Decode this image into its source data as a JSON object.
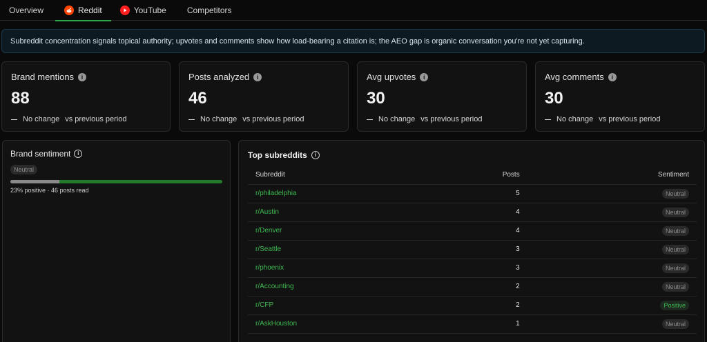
{
  "tabs": [
    {
      "label": "Overview",
      "icon": "",
      "active": false
    },
    {
      "label": "Reddit",
      "icon": "reddit-icon",
      "active": true
    },
    {
      "label": "YouTube",
      "icon": "youtube-icon",
      "active": false
    },
    {
      "label": "Competitors",
      "icon": "",
      "active": false
    }
  ],
  "banner": {
    "text": "Subreddit concentration signals topical authority; upvotes and comments show how load-bearing a citation is; the AEO gap is organic conversation you're not yet capturing."
  },
  "cards": [
    {
      "title": "Brand mentions",
      "value": "88",
      "change": "No change",
      "period": "vs previous period"
    },
    {
      "title": "Posts analyzed",
      "value": "46",
      "change": "No change",
      "period": "vs previous period"
    },
    {
      "title": "Avg upvotes",
      "value": "30",
      "change": "No change",
      "period": "vs previous period"
    },
    {
      "title": "Avg comments",
      "value": "30",
      "change": "No change",
      "period": "vs previous period"
    }
  ],
  "sentiment": {
    "title": "Brand sentiment",
    "badge": "Neutral",
    "positive_fraction": 0.23,
    "summary": "23% positive · 46 posts read"
  },
  "subreddits": {
    "title": "Top subreddits",
    "headers": {
      "subreddit": "Subreddit",
      "posts": "Posts",
      "sentiment": "Sentiment"
    },
    "rows": [
      {
        "name": "r/philadelphia",
        "posts": "5",
        "sentiment": "Neutral"
      },
      {
        "name": "r/Austin",
        "posts": "4",
        "sentiment": "Neutral"
      },
      {
        "name": "r/Denver",
        "posts": "4",
        "sentiment": "Neutral"
      },
      {
        "name": "r/Seattle",
        "posts": "3",
        "sentiment": "Neutral"
      },
      {
        "name": "r/phoenix",
        "posts": "3",
        "sentiment": "Neutral"
      },
      {
        "name": "r/Accounting",
        "posts": "2",
        "sentiment": "Neutral"
      },
      {
        "name": "r/CFP",
        "posts": "2",
        "sentiment": "Positive"
      },
      {
        "name": "r/AskHouston",
        "posts": "1",
        "sentiment": "Neutral"
      }
    ]
  },
  "colors": {
    "accent": "#2ea84a",
    "positive": "#3fb950",
    "reddit": "#ff4500",
    "youtube": "#ff1f1f"
  }
}
